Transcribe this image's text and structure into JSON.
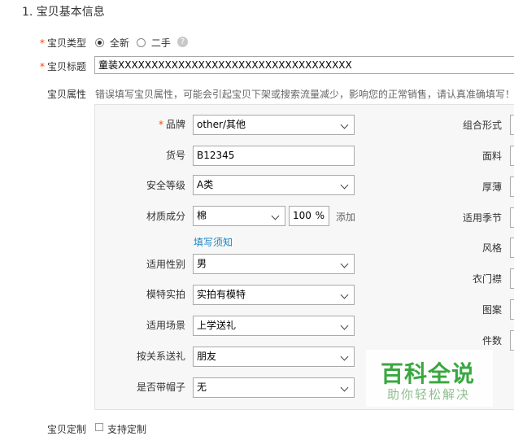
{
  "section_title": "1. 宝贝基本信息",
  "type_row": {
    "label": "宝贝类型",
    "options": [
      {
        "label": "全新",
        "checked": true
      },
      {
        "label": "二手",
        "checked": false
      }
    ],
    "help_icon": "?"
  },
  "title_row": {
    "label": "宝贝标题",
    "value": "童装XXXXXXXXXXXXXXXXXXXXXXXXXXXXXXXXXXX"
  },
  "attr_row": {
    "label": "宝贝属性",
    "warning": "错误填写宝贝属性，可能会引起宝贝下架或搜索流量减少，影响您的正常销售，请认真准确填写！"
  },
  "attributes": {
    "brand": {
      "label": "品牌",
      "value": "other/其他"
    },
    "item_no": {
      "label": "货号",
      "value": "B12345"
    },
    "safety": {
      "label": "安全等级",
      "value": "A类"
    },
    "material": {
      "label": "材质成分",
      "value": "棉",
      "percent": "100",
      "percent_unit": "%",
      "add_label": "添加",
      "notice_link": "填写须知"
    },
    "gender": {
      "label": "适用性别",
      "value": "男"
    },
    "model_photo": {
      "label": "模特实拍",
      "value": "实拍有模特"
    },
    "scene": {
      "label": "适用场景",
      "value": "上学送礼"
    },
    "relation": {
      "label": "按关系送礼",
      "value": "朋友"
    },
    "hat": {
      "label": "是否带帽子",
      "value": "无"
    }
  },
  "right_attributes": [
    "组合形式",
    "面料",
    "厚薄",
    "适用季节",
    "风格",
    "衣门襟",
    "图案",
    "件数"
  ],
  "bottom_row": {
    "label": "宝贝定制",
    "checkbox_label": "支持定制"
  },
  "watermark": {
    "title": "百科全说",
    "subtitle": "助你轻松解决"
  }
}
